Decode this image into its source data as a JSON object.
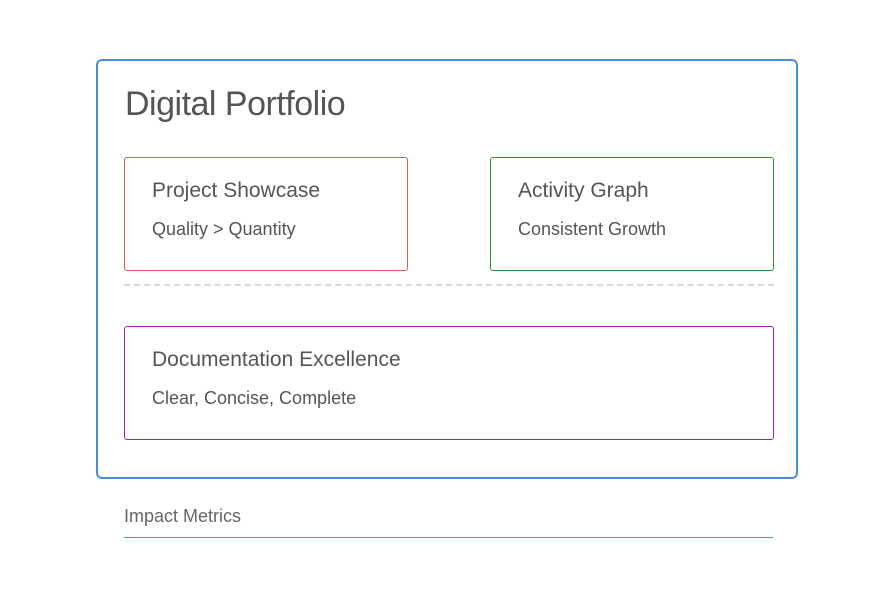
{
  "portfolio": {
    "title": "Digital Portfolio",
    "border_color": "#4a90d9",
    "cards": {
      "project_showcase": {
        "title": "Project Showcase",
        "subtitle": "Quality > Quantity",
        "border_color": "#e05555"
      },
      "activity_graph": {
        "title": "Activity Graph",
        "subtitle": "Consistent Growth",
        "border_color": "#2e8b2e"
      },
      "documentation": {
        "title": "Documentation Excellence",
        "subtitle": "Clear, Concise, Complete",
        "border_color": "#a020a0"
      }
    }
  },
  "metrics": {
    "label": "Impact Metrics",
    "line_color": "#4a90d9"
  }
}
